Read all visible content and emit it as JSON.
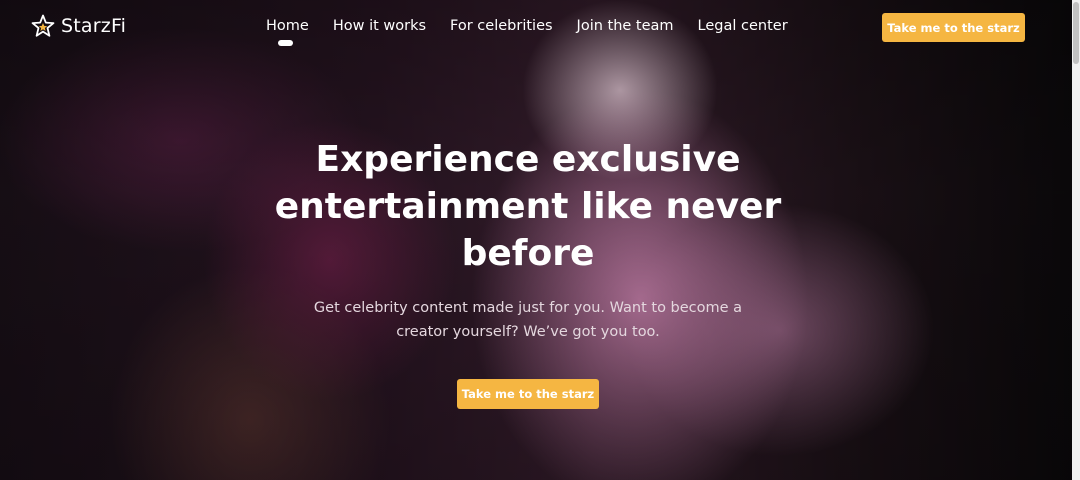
{
  "brand": {
    "name": "StarzFi",
    "logo_icon": "star-icon"
  },
  "nav": {
    "items": [
      {
        "label": "Home"
      },
      {
        "label": "How it works"
      },
      {
        "label": "For celebrities"
      },
      {
        "label": "Join the team"
      },
      {
        "label": "Legal center"
      }
    ],
    "active": "Home"
  },
  "header": {
    "cta_label": "Take me to the starz"
  },
  "hero": {
    "title": "Experience exclusive entertainment like never before",
    "subtitle": "Get celebrity content made just for you. Want to become a creator yourself? We’ve got you too.",
    "cta_label": "Take me to the starz"
  },
  "colors": {
    "accent": "#f5b642",
    "text": "#ffffff",
    "subtitle": "#e4d7de"
  }
}
